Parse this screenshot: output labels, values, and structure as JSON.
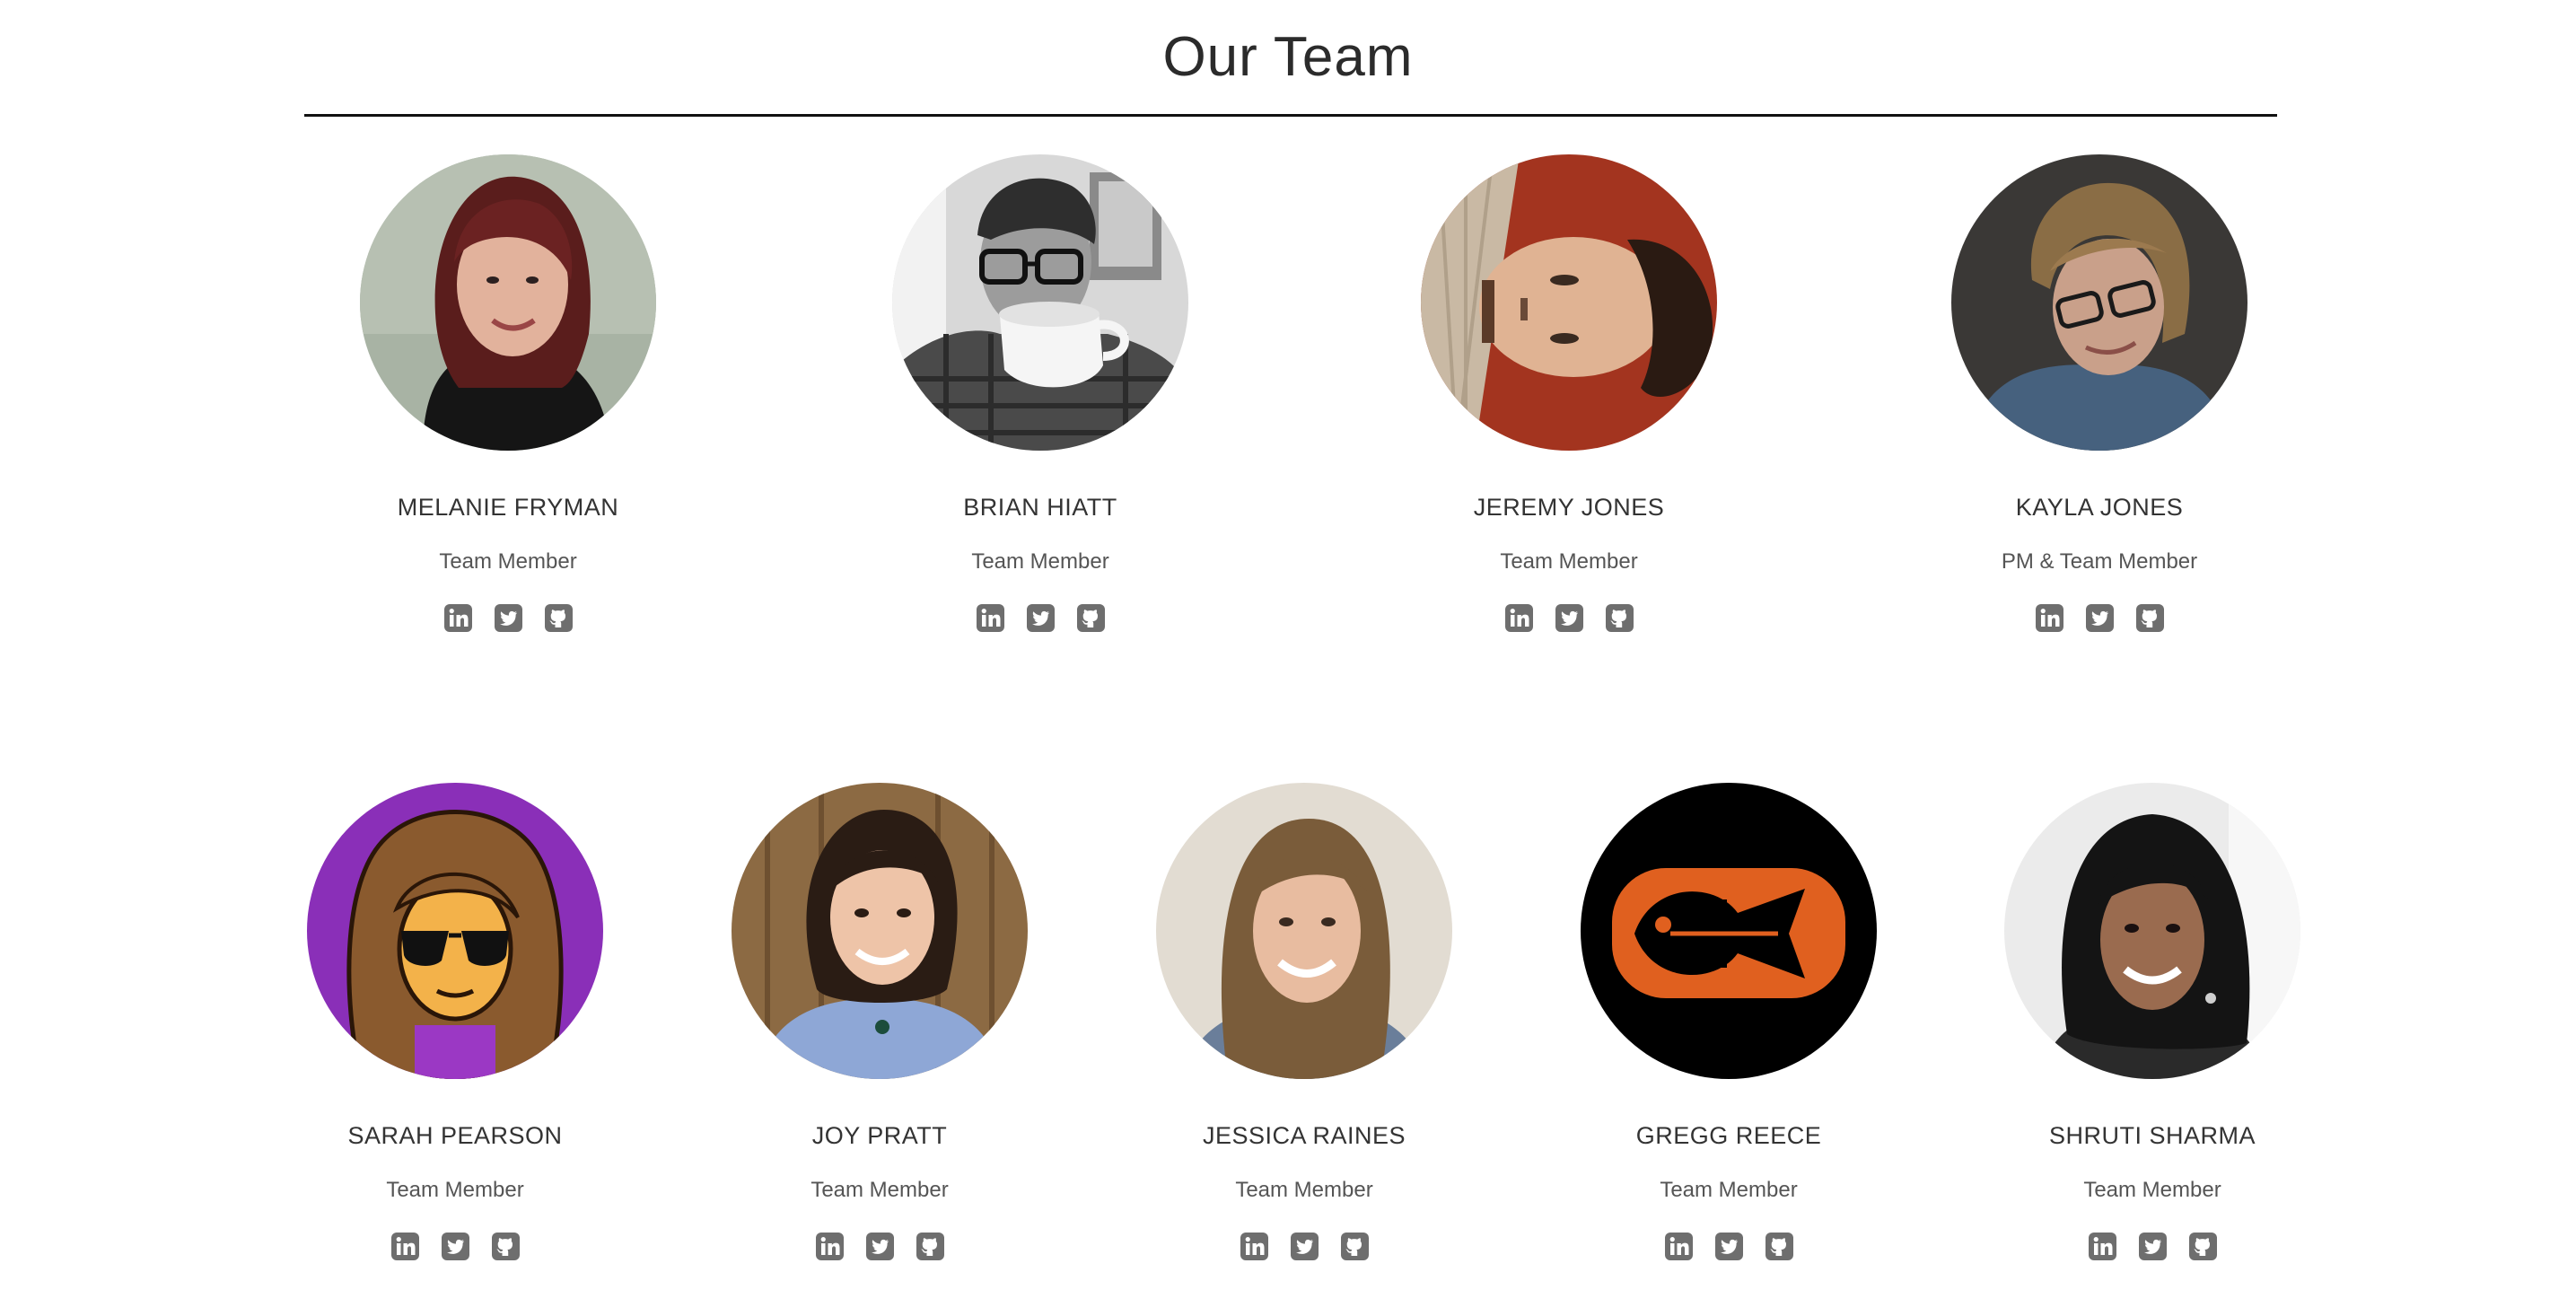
{
  "page": {
    "title": "Our Team"
  },
  "colors": {
    "icon": "#6e6e6e",
    "rule": "#111111"
  },
  "members": [
    {
      "name": "MELANIE FRYMAN",
      "role": "Team Member",
      "avatar": "photo-woman-red-hair",
      "avatar_bg": "#9aa89a"
    },
    {
      "name": "BRIAN HIATT",
      "role": "Team Member",
      "avatar": "photo-man-drinking-coffee",
      "avatar_bg": "#bdbdbd"
    },
    {
      "name": "JEREMY JONES",
      "role": "Team Member",
      "avatar": "photo-man-lying-down",
      "avatar_bg": "#a23a22"
    },
    {
      "name": "KAYLA JONES",
      "role": "PM & Team Member",
      "avatar": "photo-woman-glasses",
      "avatar_bg": "#3c3a38"
    },
    {
      "name": "SARAH PEARSON",
      "role": "Team Member",
      "avatar": "cartoon-woman-sunglasses",
      "avatar_bg": "#8a2fb8"
    },
    {
      "name": "JOY PRATT",
      "role": "Team Member",
      "avatar": "photo-woman-dark-hair",
      "avatar_bg": "#8c6a43"
    },
    {
      "name": "JESSICA RAINES",
      "role": "Team Member",
      "avatar": "photo-woman-long-hair",
      "avatar_bg": "#ddd6cc"
    },
    {
      "name": "GREGG REECE",
      "role": "Team Member",
      "avatar": "fish-skeleton-logo",
      "avatar_bg": "#000000"
    },
    {
      "name": "SHRUTI SHARMA",
      "role": "Team Member",
      "avatar": "photo-woman-smiling",
      "avatar_bg": "#e9e9e9"
    }
  ],
  "social_icons": [
    "linkedin-icon",
    "twitter-icon",
    "github-icon"
  ]
}
